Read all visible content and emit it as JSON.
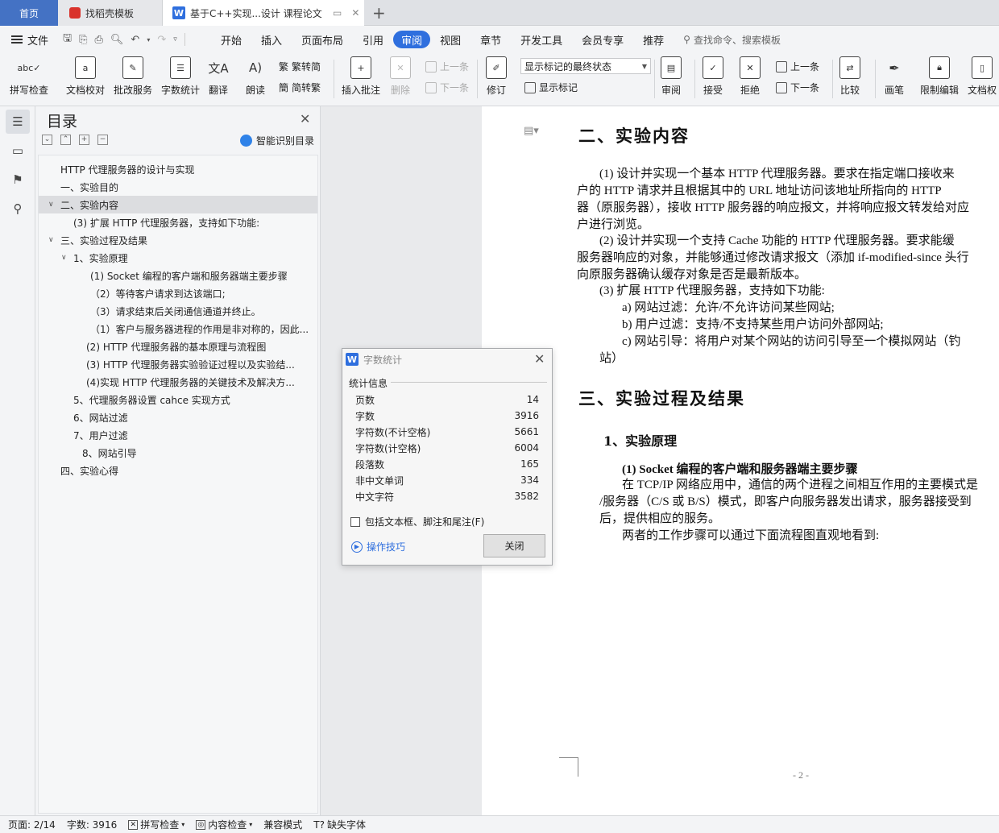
{
  "tabs": {
    "home": "首页",
    "templates": "找稻壳模板",
    "doc": "基于C++实现...设计 课程论文"
  },
  "menu": {
    "file": "文件",
    "items": [
      "开始",
      "插入",
      "页面布局",
      "引用",
      "审阅",
      "视图",
      "章节",
      "开发工具",
      "会员专享",
      "推荐"
    ],
    "active": "审阅",
    "search": "查找命令、搜索模板"
  },
  "ribbon": {
    "spell": "拼写检查",
    "proof": "文档校对",
    "correct": "批改服务",
    "count": "字数统计",
    "translate": "翻译",
    "read": "朗读",
    "to_simplified": "繁转简",
    "to_traditional": "简转繁",
    "insert_comment": "插入批注",
    "delete": "删除",
    "prev_comment": "上一条",
    "next_comment": "下一条",
    "revise": "修订",
    "markup_state": "显示标记的最终状态",
    "show_markup": "显示标记",
    "review": "审阅",
    "accept": "接受",
    "reject": "拒绝",
    "prev": "上一条",
    "next": "下一条",
    "compare": "比较",
    "pen": "画笔",
    "restrict": "限制编辑",
    "doc_perm": "文档权"
  },
  "toc": {
    "title": "目录",
    "smart": "智能识别目录",
    "items": [
      "HTTP 代理服务器的设计与实现",
      "一、实验目的",
      "二、实验内容",
      "(3)  扩展  HTTP  代理服务器，支持如下功能:",
      "三、实验过程及结果",
      "1、实验原理",
      "(1) Socket  编程的客户端和服务器端主要步骤",
      "（2）等待客户请求到达该端口;",
      "（3）请求结束后关闭通信通道并终止。",
      "（1）客户与服务器进程的作用是非对称的，因此...",
      "(2) HTTP  代理服务器的基本原理与流程图",
      "(3) HTTP  代理服务器实验验证过程以及实验结...",
      "(4)实现  HTTP  代理服务器的关键技术及解决方...",
      "5、代理服务器设置 cahce 实现方式",
      "6、网站过滤",
      "7、用户过滤",
      "8、网站引导",
      "四、实验心得"
    ]
  },
  "doc": {
    "h_content": "二、实验内容",
    "p1": [
      "(1)   设计并实现一个基本  HTTP  代理服务器。要求在指定端口接收来",
      "户的  HTTP  请求并且根据其中的  URL  地址访问该地址所指向的  HTTP",
      "器（原服务器），接收  HTTP  服务器的响应报文，并将响应报文转发给对应",
      "户进行浏览。"
    ],
    "p2": [
      "(2)   设计并实现一个支持  Cache  功能的  HTTP  代理服务器。要求能缓",
      "服务器响应的对象，并能够通过修改请求报文（添加  if-modified-since  头行",
      "向原服务器确认缓存对象是否是最新版本。"
    ],
    "p3": "(3)   扩展  HTTP  代理服务器，支持如下功能:",
    "pa": "a)    网站过滤：允许/不允许访问某些网站;",
    "pb": "b)    用户过滤：支持/不支持某些用户访问外部网站;",
    "pc": "c)    网站引导：将用户对某个网站的访问引导至一个模拟网站（钓",
    "pc2": "站）",
    "h_process": "三、实验过程及结果",
    "h_principle": "1、实验原理",
    "s_socket": "(1) Socket  编程的客户端和服务器端主要步骤",
    "p4": [
      "在 TCP/IP 网络应用中，通信的两个进程之间相互作用的主要模式是",
      "/服务器（C/S 或 B/S）模式，即客户向服务器发出请求，服务器接受到",
      "后，提供相应的服务。",
      "两者的工作步骤可以通过下面流程图直观地看到:"
    ],
    "page_no": "- 2 -"
  },
  "dialog": {
    "title": "字数统计",
    "section": "统计信息",
    "rows": [
      {
        "label": "页数",
        "value": "14"
      },
      {
        "label": "字数",
        "value": "3916"
      },
      {
        "label": "字符数(不计空格)",
        "value": "5661"
      },
      {
        "label": "字符数(计空格)",
        "value": "6004"
      },
      {
        "label": "段落数",
        "value": "165"
      },
      {
        "label": "非中文单词",
        "value": "334"
      },
      {
        "label": "中文字符",
        "value": "3582"
      }
    ],
    "include": "包括文本框、脚注和尾注(F)",
    "tips": "操作技巧",
    "close": "关闭"
  },
  "status": {
    "page": "页面: 2/14",
    "words": "字数: 3916",
    "spell": "拼写检查",
    "content_check": "内容检查",
    "compat": "兼容模式",
    "missing_font": "缺失字体"
  },
  "colors": {
    "accent": "#2f6fde",
    "home_tab": "#4472c4"
  }
}
